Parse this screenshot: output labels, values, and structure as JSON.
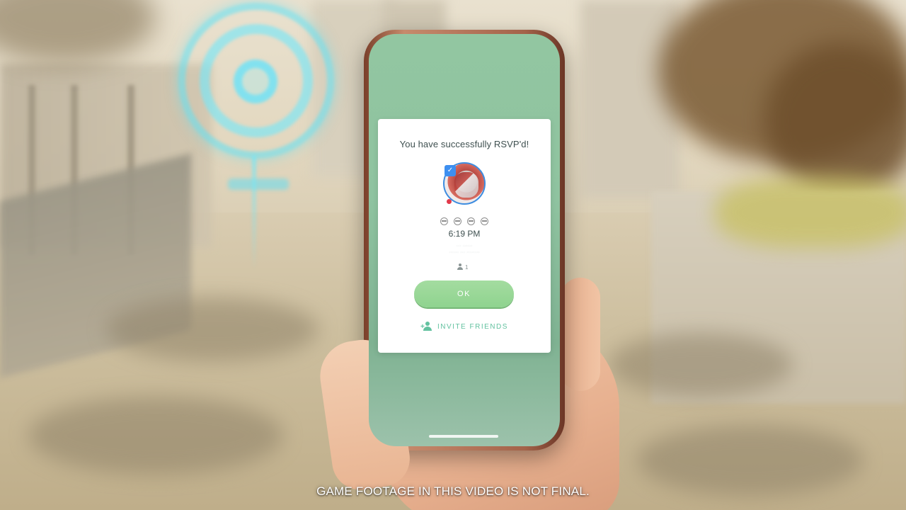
{
  "dialog": {
    "title": "You have successfully RSVP'd!",
    "time": "6:19 PM",
    "location_line1": "··· ······",
    "location_line2": "······ ··· ········",
    "attendee_count": "1",
    "ok_label": "OK",
    "invite_label": "INVITE FRIENDS",
    "difficulty_level": 4,
    "raid_boss_icon": "raid-boss-portrait"
  },
  "caption": "GAME FOOTAGE IN THIS VIDEO IS NOT FINAL.",
  "colors": {
    "screen_bg": "#8fc3a0",
    "ok_button": "#93d492",
    "invite_accent": "#63c2a0",
    "title_text": "#3f5050",
    "gym_hologram": "#6fe3f4"
  }
}
